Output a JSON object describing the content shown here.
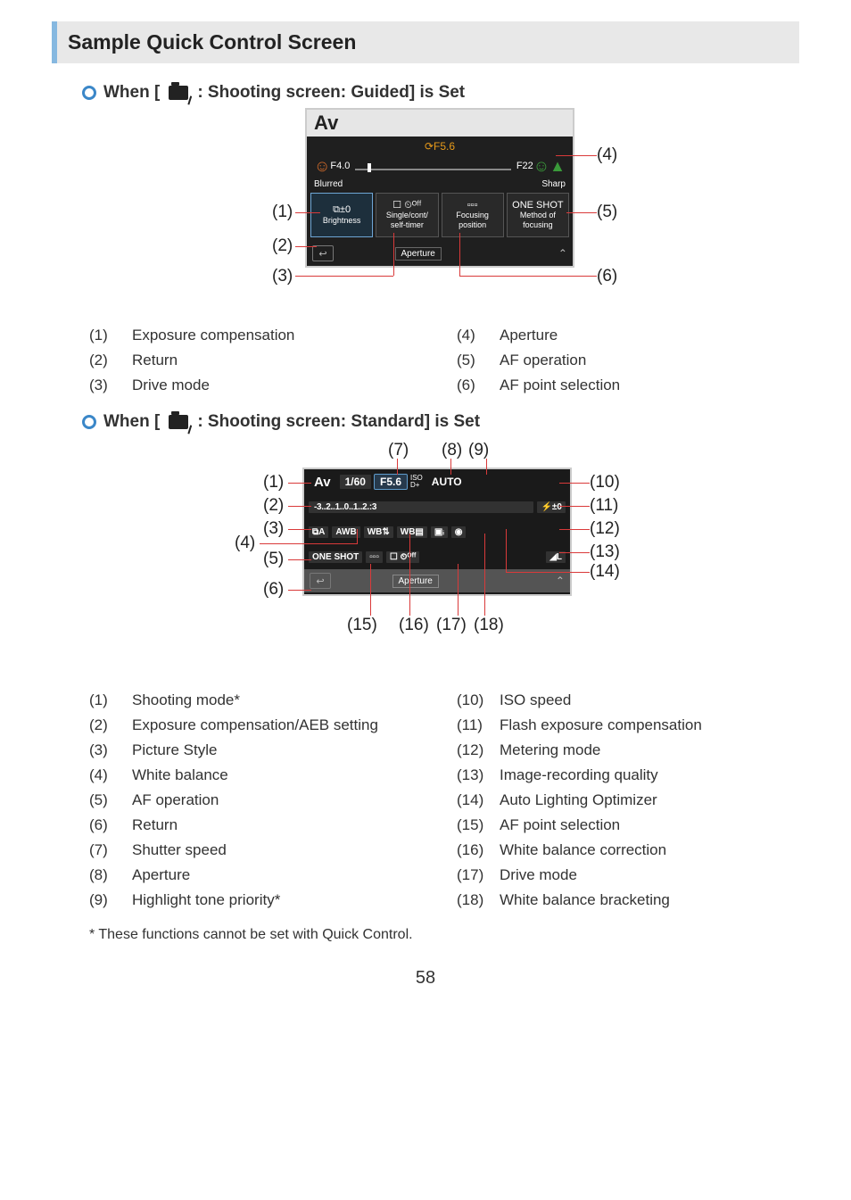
{
  "page_number": "58",
  "title": "Sample Quick Control Screen",
  "guided": {
    "heading_before": "When [",
    "heading_after": ": Shooting screen: Guided] is Set",
    "screen": {
      "mode": "Av",
      "aperture_display": "F5.6",
      "slider_min": "F4.0",
      "slider_max": "F22",
      "slider_left_label": "Blurred",
      "slider_right_label": "Sharp",
      "cell1_top": "⧉±0",
      "cell1_bottom": "Brightness",
      "cell2_top": "☐ ⏲ᴼᶠᶠ",
      "cell2_bottom1": "Single/cont/",
      "cell2_bottom2": "self-timer",
      "cell3_top": "▫▫▫",
      "cell3_bottom1": "Focusing",
      "cell3_bottom2": "position",
      "cell4_top": "ONE SHOT",
      "cell4_bottom1": "Method of",
      "cell4_bottom2": "focusing",
      "footer_label": "Aperture"
    },
    "callouts": {
      "c1": "(1)",
      "c2": "(2)",
      "c3": "(3)",
      "c4": "(4)",
      "c5": "(5)",
      "c6": "(6)"
    },
    "legend": [
      {
        "n": "(1)",
        "t": "Exposure compensation"
      },
      {
        "n": "(2)",
        "t": "Return"
      },
      {
        "n": "(3)",
        "t": "Drive mode"
      },
      {
        "n": "(4)",
        "t": "Aperture"
      },
      {
        "n": "(5)",
        "t": "AF operation"
      },
      {
        "n": "(6)",
        "t": "AF point selection"
      }
    ]
  },
  "standard": {
    "heading_before": "When [",
    "heading_after": ": Shooting screen: Standard] is Set",
    "screen": {
      "r1_mode": "Av",
      "r1_shutter": "1/60",
      "r1_aperture": "F5.6",
      "r1_htp": "D+",
      "r1_iso_label": "ISO",
      "r1_iso": "AUTO",
      "r2_scale": "-3..2..1..0..1..2.:3",
      "r2_flash": "⚡±0",
      "r3_pstyle": "⧉A",
      "r3_awb": "AWB",
      "r3_wbshift": "WB⇅",
      "r3_wbbkt": "WB▤",
      "r3_alo": "▣ᵢ",
      "r3_meter": "◉",
      "r4_af": "ONE SHOT",
      "r4_afpt": "▫▫▫",
      "r4_drive": "☐ ⏲ᴼᶠᶠ",
      "r4_qual": "◢L",
      "footer_label": "Aperture"
    },
    "callouts": {
      "c1": "(1)",
      "c2": "(2)",
      "c3": "(3)",
      "c4": "(4)",
      "c5": "(5)",
      "c6": "(6)",
      "c7": "(7)",
      "c8": "(8)",
      "c9": "(9)",
      "c10": "(10)",
      "c11": "(11)",
      "c12": "(12)",
      "c13": "(13)",
      "c14": "(14)",
      "c15": "(15)",
      "c16": "(16)",
      "c17": "(17)",
      "c18": "(18)"
    },
    "legend_left": [
      {
        "n": "(1)",
        "t": "Shooting mode*"
      },
      {
        "n": "(2)",
        "t": "Exposure compensation/AEB setting"
      },
      {
        "n": "(3)",
        "t": "Picture Style"
      },
      {
        "n": "(4)",
        "t": "White balance"
      },
      {
        "n": "(5)",
        "t": "AF operation"
      },
      {
        "n": "(6)",
        "t": "Return"
      },
      {
        "n": "(7)",
        "t": "Shutter speed"
      },
      {
        "n": "(8)",
        "t": "Aperture"
      },
      {
        "n": "(9)",
        "t": "Highlight tone priority*"
      }
    ],
    "legend_right": [
      {
        "n": "(10)",
        "t": "ISO speed"
      },
      {
        "n": "(11)",
        "t": "Flash exposure compensation"
      },
      {
        "n": "(12)",
        "t": "Metering mode"
      },
      {
        "n": "(13)",
        "t": "Image-recording quality"
      },
      {
        "n": "(14)",
        "t": "Auto Lighting Optimizer"
      },
      {
        "n": "(15)",
        "t": "AF point selection"
      },
      {
        "n": "(16)",
        "t": "White balance correction"
      },
      {
        "n": "(17)",
        "t": "Drive mode"
      },
      {
        "n": "(18)",
        "t": "White balance bracketing"
      }
    ],
    "footnote": "* These functions cannot be set with Quick Control."
  }
}
